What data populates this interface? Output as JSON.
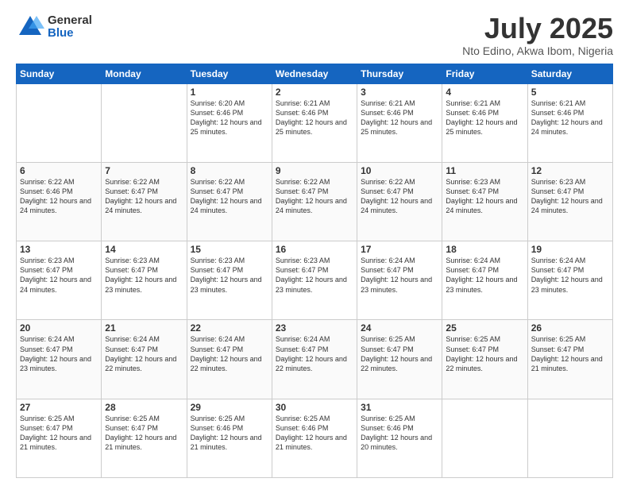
{
  "logo": {
    "general": "General",
    "blue": "Blue"
  },
  "title": "July 2025",
  "subtitle": "Nto Edino, Akwa Ibom, Nigeria",
  "days_of_week": [
    "Sunday",
    "Monday",
    "Tuesday",
    "Wednesday",
    "Thursday",
    "Friday",
    "Saturday"
  ],
  "weeks": [
    [
      {
        "day": "",
        "info": ""
      },
      {
        "day": "",
        "info": ""
      },
      {
        "day": "1",
        "info": "Sunrise: 6:20 AM\nSunset: 6:46 PM\nDaylight: 12 hours and 25 minutes."
      },
      {
        "day": "2",
        "info": "Sunrise: 6:21 AM\nSunset: 6:46 PM\nDaylight: 12 hours and 25 minutes."
      },
      {
        "day": "3",
        "info": "Sunrise: 6:21 AM\nSunset: 6:46 PM\nDaylight: 12 hours and 25 minutes."
      },
      {
        "day": "4",
        "info": "Sunrise: 6:21 AM\nSunset: 6:46 PM\nDaylight: 12 hours and 25 minutes."
      },
      {
        "day": "5",
        "info": "Sunrise: 6:21 AM\nSunset: 6:46 PM\nDaylight: 12 hours and 24 minutes."
      }
    ],
    [
      {
        "day": "6",
        "info": "Sunrise: 6:22 AM\nSunset: 6:46 PM\nDaylight: 12 hours and 24 minutes."
      },
      {
        "day": "7",
        "info": "Sunrise: 6:22 AM\nSunset: 6:47 PM\nDaylight: 12 hours and 24 minutes."
      },
      {
        "day": "8",
        "info": "Sunrise: 6:22 AM\nSunset: 6:47 PM\nDaylight: 12 hours and 24 minutes."
      },
      {
        "day": "9",
        "info": "Sunrise: 6:22 AM\nSunset: 6:47 PM\nDaylight: 12 hours and 24 minutes."
      },
      {
        "day": "10",
        "info": "Sunrise: 6:22 AM\nSunset: 6:47 PM\nDaylight: 12 hours and 24 minutes."
      },
      {
        "day": "11",
        "info": "Sunrise: 6:23 AM\nSunset: 6:47 PM\nDaylight: 12 hours and 24 minutes."
      },
      {
        "day": "12",
        "info": "Sunrise: 6:23 AM\nSunset: 6:47 PM\nDaylight: 12 hours and 24 minutes."
      }
    ],
    [
      {
        "day": "13",
        "info": "Sunrise: 6:23 AM\nSunset: 6:47 PM\nDaylight: 12 hours and 24 minutes."
      },
      {
        "day": "14",
        "info": "Sunrise: 6:23 AM\nSunset: 6:47 PM\nDaylight: 12 hours and 23 minutes."
      },
      {
        "day": "15",
        "info": "Sunrise: 6:23 AM\nSunset: 6:47 PM\nDaylight: 12 hours and 23 minutes."
      },
      {
        "day": "16",
        "info": "Sunrise: 6:23 AM\nSunset: 6:47 PM\nDaylight: 12 hours and 23 minutes."
      },
      {
        "day": "17",
        "info": "Sunrise: 6:24 AM\nSunset: 6:47 PM\nDaylight: 12 hours and 23 minutes."
      },
      {
        "day": "18",
        "info": "Sunrise: 6:24 AM\nSunset: 6:47 PM\nDaylight: 12 hours and 23 minutes."
      },
      {
        "day": "19",
        "info": "Sunrise: 6:24 AM\nSunset: 6:47 PM\nDaylight: 12 hours and 23 minutes."
      }
    ],
    [
      {
        "day": "20",
        "info": "Sunrise: 6:24 AM\nSunset: 6:47 PM\nDaylight: 12 hours and 23 minutes."
      },
      {
        "day": "21",
        "info": "Sunrise: 6:24 AM\nSunset: 6:47 PM\nDaylight: 12 hours and 22 minutes."
      },
      {
        "day": "22",
        "info": "Sunrise: 6:24 AM\nSunset: 6:47 PM\nDaylight: 12 hours and 22 minutes."
      },
      {
        "day": "23",
        "info": "Sunrise: 6:24 AM\nSunset: 6:47 PM\nDaylight: 12 hours and 22 minutes."
      },
      {
        "day": "24",
        "info": "Sunrise: 6:25 AM\nSunset: 6:47 PM\nDaylight: 12 hours and 22 minutes."
      },
      {
        "day": "25",
        "info": "Sunrise: 6:25 AM\nSunset: 6:47 PM\nDaylight: 12 hours and 22 minutes."
      },
      {
        "day": "26",
        "info": "Sunrise: 6:25 AM\nSunset: 6:47 PM\nDaylight: 12 hours and 21 minutes."
      }
    ],
    [
      {
        "day": "27",
        "info": "Sunrise: 6:25 AM\nSunset: 6:47 PM\nDaylight: 12 hours and 21 minutes."
      },
      {
        "day": "28",
        "info": "Sunrise: 6:25 AM\nSunset: 6:47 PM\nDaylight: 12 hours and 21 minutes."
      },
      {
        "day": "29",
        "info": "Sunrise: 6:25 AM\nSunset: 6:46 PM\nDaylight: 12 hours and 21 minutes."
      },
      {
        "day": "30",
        "info": "Sunrise: 6:25 AM\nSunset: 6:46 PM\nDaylight: 12 hours and 21 minutes."
      },
      {
        "day": "31",
        "info": "Sunrise: 6:25 AM\nSunset: 6:46 PM\nDaylight: 12 hours and 20 minutes."
      },
      {
        "day": "",
        "info": ""
      },
      {
        "day": "",
        "info": ""
      }
    ]
  ]
}
